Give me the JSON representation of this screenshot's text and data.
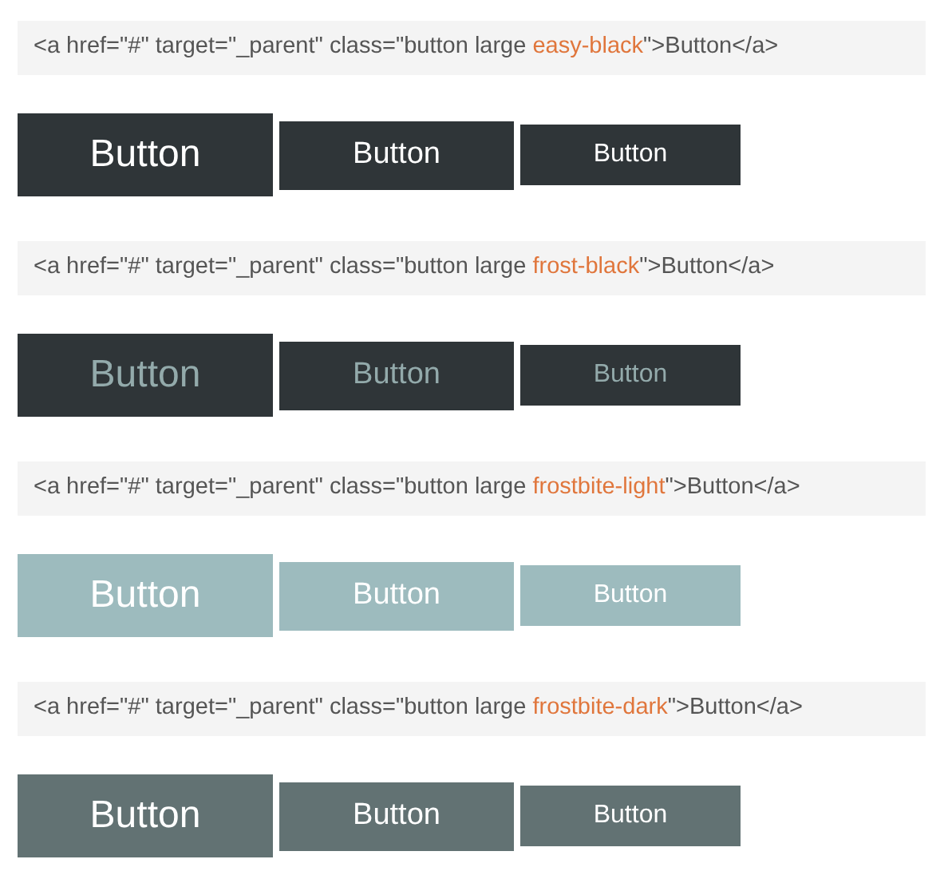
{
  "sections": [
    {
      "code": {
        "before": "<a href=\"#\" target=\"_parent\" class=\"button large ",
        "highlight": "easy-black",
        "after": "\">Button</a>"
      },
      "buttons": [
        "Button",
        "Button",
        "Button"
      ]
    },
    {
      "code": {
        "before": "<a href=\"#\" target=\"_parent\" class=\"button large ",
        "highlight": "frost-black",
        "after": "\">Button</a>"
      },
      "buttons": [
        "Button",
        "Button",
        "Button"
      ]
    },
    {
      "code": {
        "before": "<a href=\"#\" target=\"_parent\" class=\"button large ",
        "highlight": "frostbite-light",
        "after": "\">Button</a>"
      },
      "buttons": [
        "Button",
        "Button",
        "Button"
      ]
    },
    {
      "code": {
        "before": "<a href=\"#\" target=\"_parent\" class=\"button large ",
        "highlight": "frostbite-dark",
        "after": "\">Button</a>"
      },
      "buttons": [
        "Button",
        "Button",
        "Button"
      ]
    }
  ]
}
